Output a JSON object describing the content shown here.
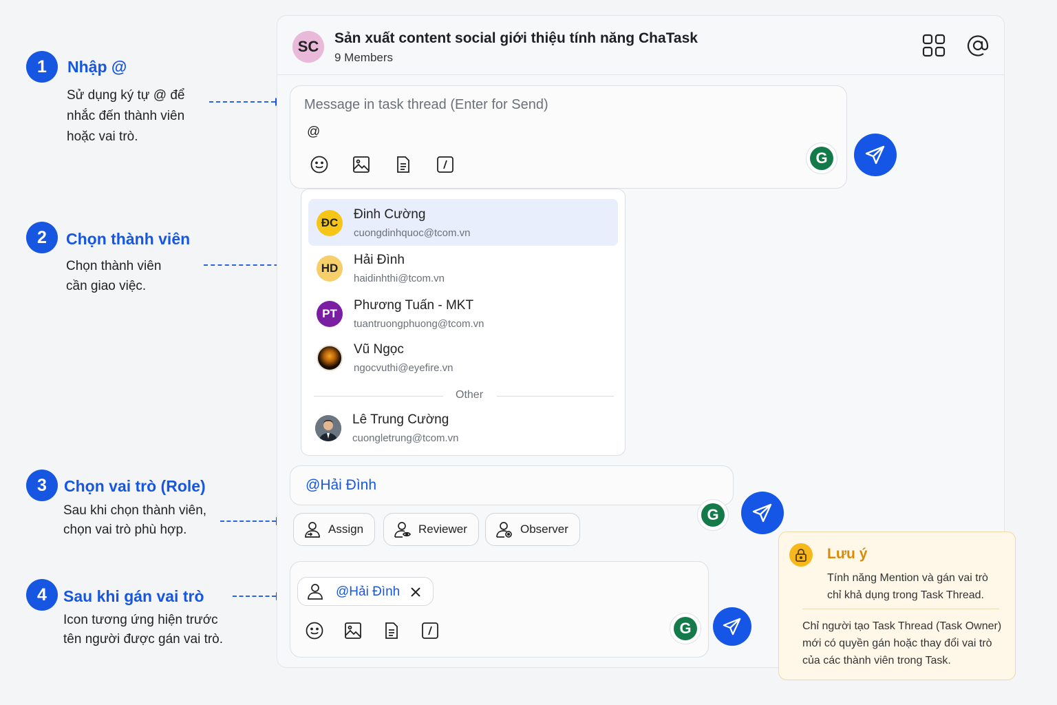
{
  "steps": [
    {
      "number": "1",
      "title": "Nhập @",
      "desc": [
        "Sử dụng ký tự @ để",
        "nhắc đến thành viên",
        "hoặc vai trò."
      ]
    },
    {
      "number": "2",
      "title": "Chọn thành viên",
      "desc": [
        "Chọn thành viên",
        "cần giao việc."
      ]
    },
    {
      "number": "3",
      "title": "Chọn vai trò (Role)",
      "desc": [
        "Sau khi chọn thành viên,",
        "chọn vai trò phù hợp."
      ]
    },
    {
      "number": "4",
      "title": "Sau khi gán vai trò",
      "desc": [
        "Icon tương ứng hiện trước",
        "tên người được gán vai trò."
      ]
    }
  ],
  "thread": {
    "avatar": "SC",
    "title": "Sản xuất content social giới thiệu tính năng ChaTask",
    "members": "9 Members"
  },
  "composer": {
    "placeholder": "Message in task thread (Enter for Send)",
    "typed": "@",
    "grammarly": "G"
  },
  "dropdown": {
    "members": [
      {
        "initials": "ĐC",
        "name": "Đinh Cường",
        "email": "cuongdinhquoc@tcom.vn",
        "color": "#f5c518",
        "text_color": "#222",
        "selected": true
      },
      {
        "initials": "HD",
        "name": "Hải Đình",
        "email": "haidinhthi@tcom.vn",
        "color": "#f6cf6a",
        "text_color": "#222",
        "selected": false
      },
      {
        "initials": "PT",
        "name": "Phương Tuấn - MKT",
        "email": "tuantruongphuong@tcom.vn",
        "color": "#7a1fa2",
        "text_color": "#fff",
        "selected": false
      },
      {
        "initials": "",
        "name": "Vũ Ngọc",
        "email": "ngocvuthi@eyefire.vn",
        "color": "#2b1a06",
        "text_color": "#fff",
        "selected": false
      }
    ],
    "other_label": "Other",
    "other": {
      "name": "Lê Trung Cường",
      "email": "cuongletrung@tcom.vn"
    }
  },
  "mention": {
    "text": "@Hải Đình",
    "roles": [
      {
        "label": "Assign",
        "icon": "user-assign-icon"
      },
      {
        "label": "Reviewer",
        "icon": "user-review-icon"
      },
      {
        "label": "Observer",
        "icon": "user-observe-icon"
      }
    ]
  },
  "assigned": {
    "chip_text": "@Hải Đình"
  },
  "note": {
    "title": "Lưu ý",
    "line1": "Tính năng Mention và gán vai trò",
    "line2": "chỉ khả dụng trong Task Thread.",
    "line3": "Chỉ người tạo Task Thread (Task Owner)",
    "line4": "mới có quyền gán hoặc thay đổi vai trò",
    "line5": "của các thành viên trong Task."
  },
  "colors": {
    "accent": "#1656e0",
    "send": "#1556e6",
    "grammarly": "#147a4a",
    "note_bg": "#fff8e9",
    "note_title": "#d88a06"
  }
}
